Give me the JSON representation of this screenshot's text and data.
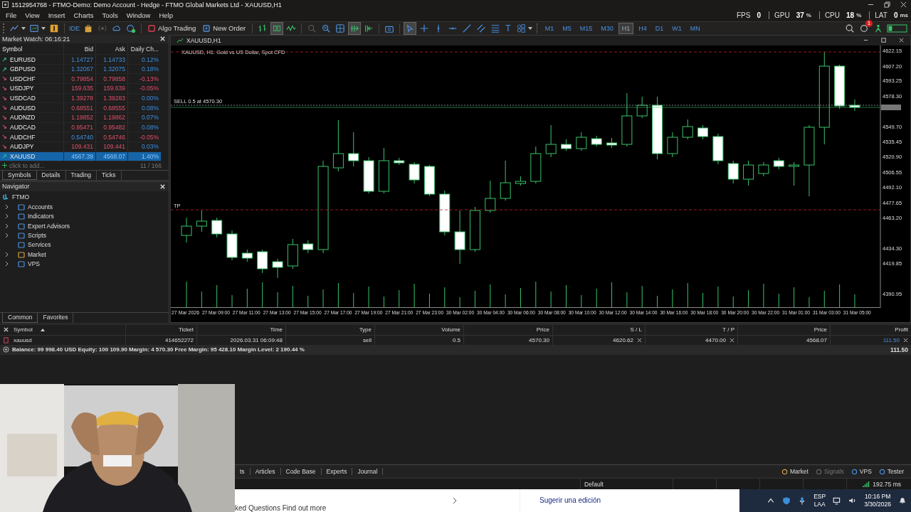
{
  "window": {
    "title": "1512954768 - FTMO-Demo: Demo Account - Hedge - FTMO Global Markets Ltd - XAUUSD,H1"
  },
  "perf": [
    {
      "label": "FPS",
      "value": "0"
    },
    {
      "label": "GPU",
      "value": "37",
      "unit": "%"
    },
    {
      "label": "CPU",
      "value": "18",
      "unit": "%"
    },
    {
      "label": "LAT",
      "value": "0",
      "unit": "ms"
    }
  ],
  "menu": [
    "File",
    "View",
    "Insert",
    "Charts",
    "Tools",
    "Window",
    "Help"
  ],
  "toolbar": {
    "ide": "IDE",
    "algo_trading": "Algo Trading",
    "new_order": "New Order",
    "text_tool": "T",
    "notification_badge": "1",
    "timeframes": [
      {
        "label": "M1",
        "selected": false
      },
      {
        "label": "M5",
        "selected": false
      },
      {
        "label": "M15",
        "selected": false
      },
      {
        "label": "M30",
        "selected": false
      },
      {
        "label": "H1",
        "selected": true
      },
      {
        "label": "H4",
        "selected": false
      },
      {
        "label": "D1",
        "selected": false
      },
      {
        "label": "W1",
        "selected": false
      },
      {
        "label": "MN",
        "selected": false
      }
    ]
  },
  "market_watch": {
    "title": "Market Watch: 06:16:21",
    "columns": [
      "Symbol",
      "Bid",
      "Ask",
      "Daily Ch..."
    ],
    "rows": [
      {
        "symbol": "EURUSD",
        "bid": "1.14727",
        "ask": "1.14733",
        "change": "0.12%",
        "rising": true,
        "bid_rising": true,
        "ask_rising": true,
        "change_positive": true,
        "selected": false
      },
      {
        "symbol": "GBPUSD",
        "bid": "1.32067",
        "ask": "1.32075",
        "change": "0.18%",
        "rising": true,
        "bid_rising": true,
        "ask_rising": true,
        "change_positive": true,
        "selected": false
      },
      {
        "symbol": "USDCHF",
        "bid": "0.79854",
        "ask": "0.79858",
        "change": "-0.13%",
        "rising": false,
        "bid_rising": false,
        "ask_rising": false,
        "change_positive": false,
        "selected": false
      },
      {
        "symbol": "USDJPY",
        "bid": "159.635",
        "ask": "159.639",
        "change": "-0.05%",
        "rising": false,
        "bid_rising": false,
        "ask_rising": false,
        "change_positive": false,
        "selected": false
      },
      {
        "symbol": "USDCAD",
        "bid": "1.39278",
        "ask": "1.39283",
        "change": "0.00%",
        "rising": false,
        "bid_rising": false,
        "ask_rising": false,
        "change_positive": true,
        "selected": false
      },
      {
        "symbol": "AUDUSD",
        "bid": "0.68551",
        "ask": "0.68555",
        "change": "0.08%",
        "rising": false,
        "bid_rising": false,
        "ask_rising": false,
        "change_positive": true,
        "selected": false
      },
      {
        "symbol": "AUDNZD",
        "bid": "1.19852",
        "ask": "1.19862",
        "change": "0.07%",
        "rising": false,
        "bid_rising": false,
        "ask_rising": false,
        "change_positive": true,
        "selected": false
      },
      {
        "symbol": "AUDCAD",
        "bid": "0.95471",
        "ask": "0.95482",
        "change": "0.08%",
        "rising": false,
        "bid_rising": false,
        "ask_rising": false,
        "change_positive": true,
        "selected": false
      },
      {
        "symbol": "AUDCHF",
        "bid": "0.54740",
        "ask": "0.54746",
        "change": "-0.05%",
        "rising": false,
        "bid_rising": true,
        "ask_rising": false,
        "change_positive": false,
        "selected": false
      },
      {
        "symbol": "AUDJPY",
        "bid": "109.431",
        "ask": "109.441",
        "change": "0.03%",
        "rising": false,
        "bid_rising": false,
        "ask_rising": false,
        "change_positive": true,
        "selected": false
      },
      {
        "symbol": "XAUUSD",
        "bid": "4567.39",
        "ask": "4568.07",
        "change": "1.40%",
        "rising": true,
        "bid_rising": true,
        "ask_rising": true,
        "change_positive": true,
        "selected": true
      }
    ],
    "add_hint": "click to add...",
    "count": "11 / 166",
    "tabs": [
      {
        "label": "Symbols",
        "selected": true
      },
      {
        "label": "Details",
        "selected": false
      },
      {
        "label": "Trading",
        "selected": false
      },
      {
        "label": "Ticks",
        "selected": false
      }
    ]
  },
  "navigator": {
    "title": "Navigator",
    "root": {
      "label": "FTMO",
      "children": [
        {
          "label": "Accounts",
          "expandable": true
        },
        {
          "label": "Indicators",
          "expandable": true
        },
        {
          "label": "Expert Advisors",
          "expandable": true
        },
        {
          "label": "Scripts",
          "expandable": true
        },
        {
          "label": "Services",
          "expandable": false
        },
        {
          "label": "Market",
          "expandable": true
        },
        {
          "label": "VPS",
          "expandable": true
        }
      ]
    },
    "tabs": [
      {
        "label": "Common",
        "selected": true
      },
      {
        "label": "Favorites",
        "selected": false
      }
    ]
  },
  "chart": {
    "window_title": "XAUUSD,H1",
    "caption": "XAUUSD, H1:  Gold vs US Dollar, Spot CFD",
    "sell_label": "SELL 0.5 at 4570.30",
    "tp_label": "TP",
    "chart_data": {
      "type": "candlestick",
      "ohlc": [
        [
          4446.6,
          4463.47,
          4439.85,
          4455.37
        ],
        [
          4455.37,
          4470.23,
          4449.97,
          4460.1
        ],
        [
          4460.77,
          4463.47,
          4444.57,
          4447.95
        ],
        [
          4447.95,
          4451.32,
          4422.97,
          4425.67
        ],
        [
          4429.72,
          4433.1,
          4421.62,
          4424.99
        ],
        [
          4431.07,
          4433.1,
          4410.82,
          4414.87
        ],
        [
          4421.62,
          4424.32,
          4406.09,
          4416.22
        ],
        [
          4417.57,
          4443.22,
          4414.87,
          4437.82
        ],
        [
          4438.5,
          4441.87,
          4429.72,
          4433.1
        ],
        [
          4433.1,
          4517.49,
          4429.72,
          4512.09
        ],
        [
          4510.74,
          4555.98,
          4507.39,
          4524.25
        ],
        [
          4524.25,
          4544.5,
          4512.09,
          4517.49
        ],
        [
          4517.49,
          4520.87,
          4486.43,
          4488.46
        ],
        [
          4488.46,
          4529.65,
          4486.43,
          4517.49
        ],
        [
          4517.49,
          4520.19,
          4513.44,
          4515.47
        ],
        [
          4514.12,
          4516.14,
          4495.89,
          4499.26
        ],
        [
          4512.09,
          4513.44,
          4483.73,
          4485.76
        ],
        [
          4485.76,
          4489.13,
          4446.6,
          4449.97
        ],
        [
          4449.97,
          4470.23,
          4419.59,
          4433.1
        ],
        [
          4433.1,
          4473.6,
          4431.07,
          4470.23
        ],
        [
          4470.23,
          4498.59,
          4468.2,
          4481.71
        ],
        [
          4481.71,
          4517.49,
          4479.68,
          4496.56
        ],
        [
          4495.89,
          4502.64,
          4493.86,
          4497.91
        ],
        [
          4497.91,
          4531.0,
          4495.89,
          4524.25
        ],
        [
          4524.25,
          4551.25,
          4520.87,
          4533.02
        ],
        [
          4533.02,
          4537.75,
          4526.95,
          4528.97
        ],
        [
          4528.97,
          4544.5,
          4526.95,
          4539.77
        ],
        [
          4538.42,
          4541.12,
          4531.0,
          4533.02
        ],
        [
          4534.37,
          4539.1,
          4529.65,
          4532.35
        ],
        [
          4533.02,
          4581.64,
          4531.0,
          4560.03
        ],
        [
          4560.03,
          4578.26,
          4558.0,
          4570.16
        ],
        [
          4570.16,
          4578.26,
          4518.84,
          4524.25
        ],
        [
          4524.25,
          4544.5,
          4520.87,
          4539.77
        ],
        [
          4539.77,
          4556.66,
          4537.75,
          4549.9
        ],
        [
          4548.55,
          4551.25,
          4537.75,
          4540.45
        ],
        [
          4540.45,
          4543.15,
          4514.12,
          4517.49
        ],
        [
          4514.79,
          4517.49,
          4495.89,
          4499.94
        ],
        [
          4499.94,
          4517.49,
          4493.86,
          4513.44
        ],
        [
          4505.34,
          4516.14,
          4502.64,
          4513.44
        ],
        [
          4517.49,
          4520.19,
          4509.39,
          4512.09
        ],
        [
          4512.09,
          4516.14,
          4493.86,
          4513.44
        ],
        [
          4513.44,
          4551.25,
          4483.73,
          4549.23
        ],
        [
          4549.23,
          4620.8,
          4533.02,
          4607.3
        ],
        [
          4607.3,
          4608.65,
          4566.78,
          4569.48
        ],
        [
          4570.16,
          4575.56,
          4564.75,
          4568.13
        ]
      ],
      "yticks": [
        {
          "value": 4622.15,
          "label": "4622.15"
        },
        {
          "value": 4607.2,
          "label": "4607.20"
        },
        {
          "value": 4593.25,
          "label": "4593.25"
        },
        {
          "value": 4578.3,
          "label": "4578.30"
        },
        {
          "value": 4549.7,
          "label": "4549.70"
        },
        {
          "value": 4535.45,
          "label": "4535.45"
        },
        {
          "value": 4520.9,
          "label": "4520.90"
        },
        {
          "value": 4506.55,
          "label": "4506.55"
        },
        {
          "value": 4492.1,
          "label": "4492.10"
        },
        {
          "value": 4477.65,
          "label": "4477.65"
        },
        {
          "value": 4463.2,
          "label": "4463.20"
        },
        {
          "value": 4434.3,
          "label": "4434.30"
        },
        {
          "value": 4419.85,
          "label": "4419.85"
        },
        {
          "value": 4390.95,
          "label": "4390.95"
        }
      ],
      "ylim": [
        4377.73,
        4626.88
      ]
    },
    "time_labels": [
      "27 Mar 2026",
      "27 Mar 09:00",
      "27 Mar 11:00",
      "27 Mar 13:00",
      "27 Mar 15:00",
      "27 Mar 17:00",
      "27 Mar 19:00",
      "27 Mar 21:00",
      "27 Mar 23:00",
      "30 Mar 02:00",
      "30 Mar 04:00",
      "30 Mar 06:00",
      "30 Mar 08:00",
      "30 Mar 10:00",
      "30 Mar 12:00",
      "30 Mar 14:00",
      "30 Mar 16:00",
      "30 Mar 18:00",
      "30 Mar 20:00",
      "30 Mar 22:00",
      "31 Mar 01:00",
      "31 Mar 03:00",
      "31 Mar 05:00"
    ]
  },
  "positions": {
    "columns": [
      {
        "label": "Symbol",
        "sorted": true
      },
      {
        "label": "Ticket",
        "sorted": false
      },
      {
        "label": "Time",
        "sorted": false
      },
      {
        "label": "Type",
        "sorted": false
      },
      {
        "label": "Volume",
        "sorted": false
      },
      {
        "label": "Price",
        "sorted": false
      },
      {
        "label": "S / L",
        "sorted": false
      },
      {
        "label": "T / P",
        "sorted": false
      },
      {
        "label": "Price",
        "sorted": false
      },
      {
        "label": "Profit",
        "sorted": false
      }
    ],
    "rows": [
      {
        "cells": [
          "xauusd",
          "414652272",
          "2026.03.31 06:09:48",
          "sell",
          "0.5",
          "4570.30",
          "4620.62",
          "4470.00",
          "4568.07",
          "111.50"
        ]
      }
    ],
    "balance": "Balance: 99 998.40 USD  Equity: 100 109.90  Margin: 4 570.30  Free Margin: 95 428.10  Margin Level: 2 190.44 %",
    "total": "111.50"
  },
  "toolbox_tabs": [
    {
      "label": "ts"
    },
    {
      "label": "Articles"
    },
    {
      "label": "Code Base"
    },
    {
      "label": "Experts"
    },
    {
      "label": "Journal"
    }
  ],
  "services": [
    {
      "label": "Market",
      "disabled": false
    },
    {
      "label": "Signals",
      "disabled": true
    },
    {
      "label": "VPS",
      "disabled": false
    },
    {
      "label": "Tester",
      "disabled": false
    }
  ],
  "status_bar": {
    "profile": "Default",
    "ping": "192.75 ms"
  },
  "browser": {
    "text": "ked Questions Find out more",
    "link": "Sugerir una edición"
  },
  "taskbar": {
    "language": "ESP",
    "layout": "LAA",
    "time": "10:16 PM",
    "date": "3/30/2026"
  }
}
